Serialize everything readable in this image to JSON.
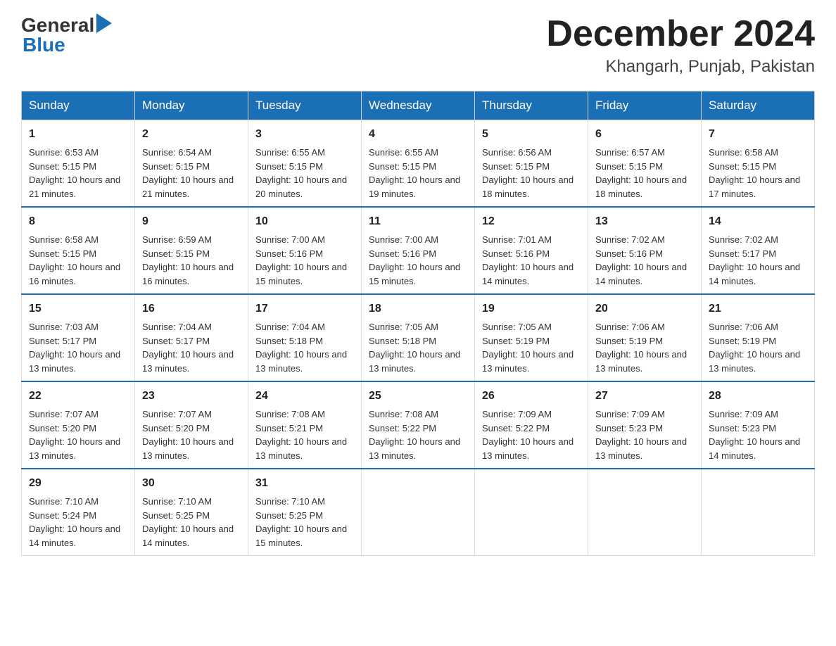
{
  "header": {
    "logo_general": "General",
    "logo_blue": "Blue",
    "month_title": "December 2024",
    "location": "Khangarh, Punjab, Pakistan"
  },
  "days_of_week": [
    "Sunday",
    "Monday",
    "Tuesday",
    "Wednesday",
    "Thursday",
    "Friday",
    "Saturday"
  ],
  "weeks": [
    [
      {
        "day": "1",
        "sunrise": "6:53 AM",
        "sunset": "5:15 PM",
        "daylight": "10 hours and 21 minutes."
      },
      {
        "day": "2",
        "sunrise": "6:54 AM",
        "sunset": "5:15 PM",
        "daylight": "10 hours and 21 minutes."
      },
      {
        "day": "3",
        "sunrise": "6:55 AM",
        "sunset": "5:15 PM",
        "daylight": "10 hours and 20 minutes."
      },
      {
        "day": "4",
        "sunrise": "6:55 AM",
        "sunset": "5:15 PM",
        "daylight": "10 hours and 19 minutes."
      },
      {
        "day": "5",
        "sunrise": "6:56 AM",
        "sunset": "5:15 PM",
        "daylight": "10 hours and 18 minutes."
      },
      {
        "day": "6",
        "sunrise": "6:57 AM",
        "sunset": "5:15 PM",
        "daylight": "10 hours and 18 minutes."
      },
      {
        "day": "7",
        "sunrise": "6:58 AM",
        "sunset": "5:15 PM",
        "daylight": "10 hours and 17 minutes."
      }
    ],
    [
      {
        "day": "8",
        "sunrise": "6:58 AM",
        "sunset": "5:15 PM",
        "daylight": "10 hours and 16 minutes."
      },
      {
        "day": "9",
        "sunrise": "6:59 AM",
        "sunset": "5:15 PM",
        "daylight": "10 hours and 16 minutes."
      },
      {
        "day": "10",
        "sunrise": "7:00 AM",
        "sunset": "5:16 PM",
        "daylight": "10 hours and 15 minutes."
      },
      {
        "day": "11",
        "sunrise": "7:00 AM",
        "sunset": "5:16 PM",
        "daylight": "10 hours and 15 minutes."
      },
      {
        "day": "12",
        "sunrise": "7:01 AM",
        "sunset": "5:16 PM",
        "daylight": "10 hours and 14 minutes."
      },
      {
        "day": "13",
        "sunrise": "7:02 AM",
        "sunset": "5:16 PM",
        "daylight": "10 hours and 14 minutes."
      },
      {
        "day": "14",
        "sunrise": "7:02 AM",
        "sunset": "5:17 PM",
        "daylight": "10 hours and 14 minutes."
      }
    ],
    [
      {
        "day": "15",
        "sunrise": "7:03 AM",
        "sunset": "5:17 PM",
        "daylight": "10 hours and 13 minutes."
      },
      {
        "day": "16",
        "sunrise": "7:04 AM",
        "sunset": "5:17 PM",
        "daylight": "10 hours and 13 minutes."
      },
      {
        "day": "17",
        "sunrise": "7:04 AM",
        "sunset": "5:18 PM",
        "daylight": "10 hours and 13 minutes."
      },
      {
        "day": "18",
        "sunrise": "7:05 AM",
        "sunset": "5:18 PM",
        "daylight": "10 hours and 13 minutes."
      },
      {
        "day": "19",
        "sunrise": "7:05 AM",
        "sunset": "5:19 PM",
        "daylight": "10 hours and 13 minutes."
      },
      {
        "day": "20",
        "sunrise": "7:06 AM",
        "sunset": "5:19 PM",
        "daylight": "10 hours and 13 minutes."
      },
      {
        "day": "21",
        "sunrise": "7:06 AM",
        "sunset": "5:19 PM",
        "daylight": "10 hours and 13 minutes."
      }
    ],
    [
      {
        "day": "22",
        "sunrise": "7:07 AM",
        "sunset": "5:20 PM",
        "daylight": "10 hours and 13 minutes."
      },
      {
        "day": "23",
        "sunrise": "7:07 AM",
        "sunset": "5:20 PM",
        "daylight": "10 hours and 13 minutes."
      },
      {
        "day": "24",
        "sunrise": "7:08 AM",
        "sunset": "5:21 PM",
        "daylight": "10 hours and 13 minutes."
      },
      {
        "day": "25",
        "sunrise": "7:08 AM",
        "sunset": "5:22 PM",
        "daylight": "10 hours and 13 minutes."
      },
      {
        "day": "26",
        "sunrise": "7:09 AM",
        "sunset": "5:22 PM",
        "daylight": "10 hours and 13 minutes."
      },
      {
        "day": "27",
        "sunrise": "7:09 AM",
        "sunset": "5:23 PM",
        "daylight": "10 hours and 13 minutes."
      },
      {
        "day": "28",
        "sunrise": "7:09 AM",
        "sunset": "5:23 PM",
        "daylight": "10 hours and 14 minutes."
      }
    ],
    [
      {
        "day": "29",
        "sunrise": "7:10 AM",
        "sunset": "5:24 PM",
        "daylight": "10 hours and 14 minutes."
      },
      {
        "day": "30",
        "sunrise": "7:10 AM",
        "sunset": "5:25 PM",
        "daylight": "10 hours and 14 minutes."
      },
      {
        "day": "31",
        "sunrise": "7:10 AM",
        "sunset": "5:25 PM",
        "daylight": "10 hours and 15 minutes."
      },
      null,
      null,
      null,
      null
    ]
  ]
}
